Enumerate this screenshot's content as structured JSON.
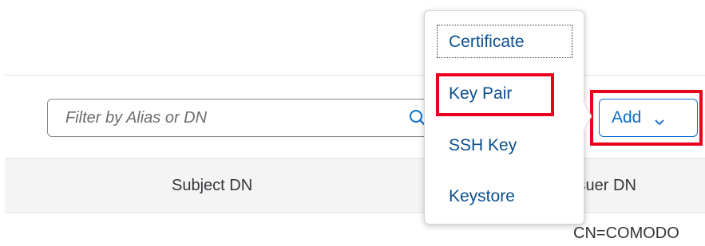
{
  "filter": {
    "placeholder": "Filter by Alias or DN",
    "value": "",
    "icon": "search-icon"
  },
  "toolbar": {
    "add_label": "Add",
    "add_icon": "chevron-down-icon"
  },
  "add_menu": {
    "items": [
      {
        "label": "Certificate",
        "focused": true
      },
      {
        "label": "Key Pair",
        "highlighted": true
      },
      {
        "label": "SSH Key"
      },
      {
        "label": "Keystore"
      }
    ]
  },
  "table": {
    "columns": [
      "Subject DN",
      "Issuer DN"
    ],
    "rows": [
      {
        "issuer_dn": "CN=COMODO"
      }
    ]
  },
  "colors": {
    "accent": "#0a6ed1",
    "menu_text": "#0a4f8f",
    "highlight": "#e8001c",
    "header_bg": "#f4f4f4"
  }
}
